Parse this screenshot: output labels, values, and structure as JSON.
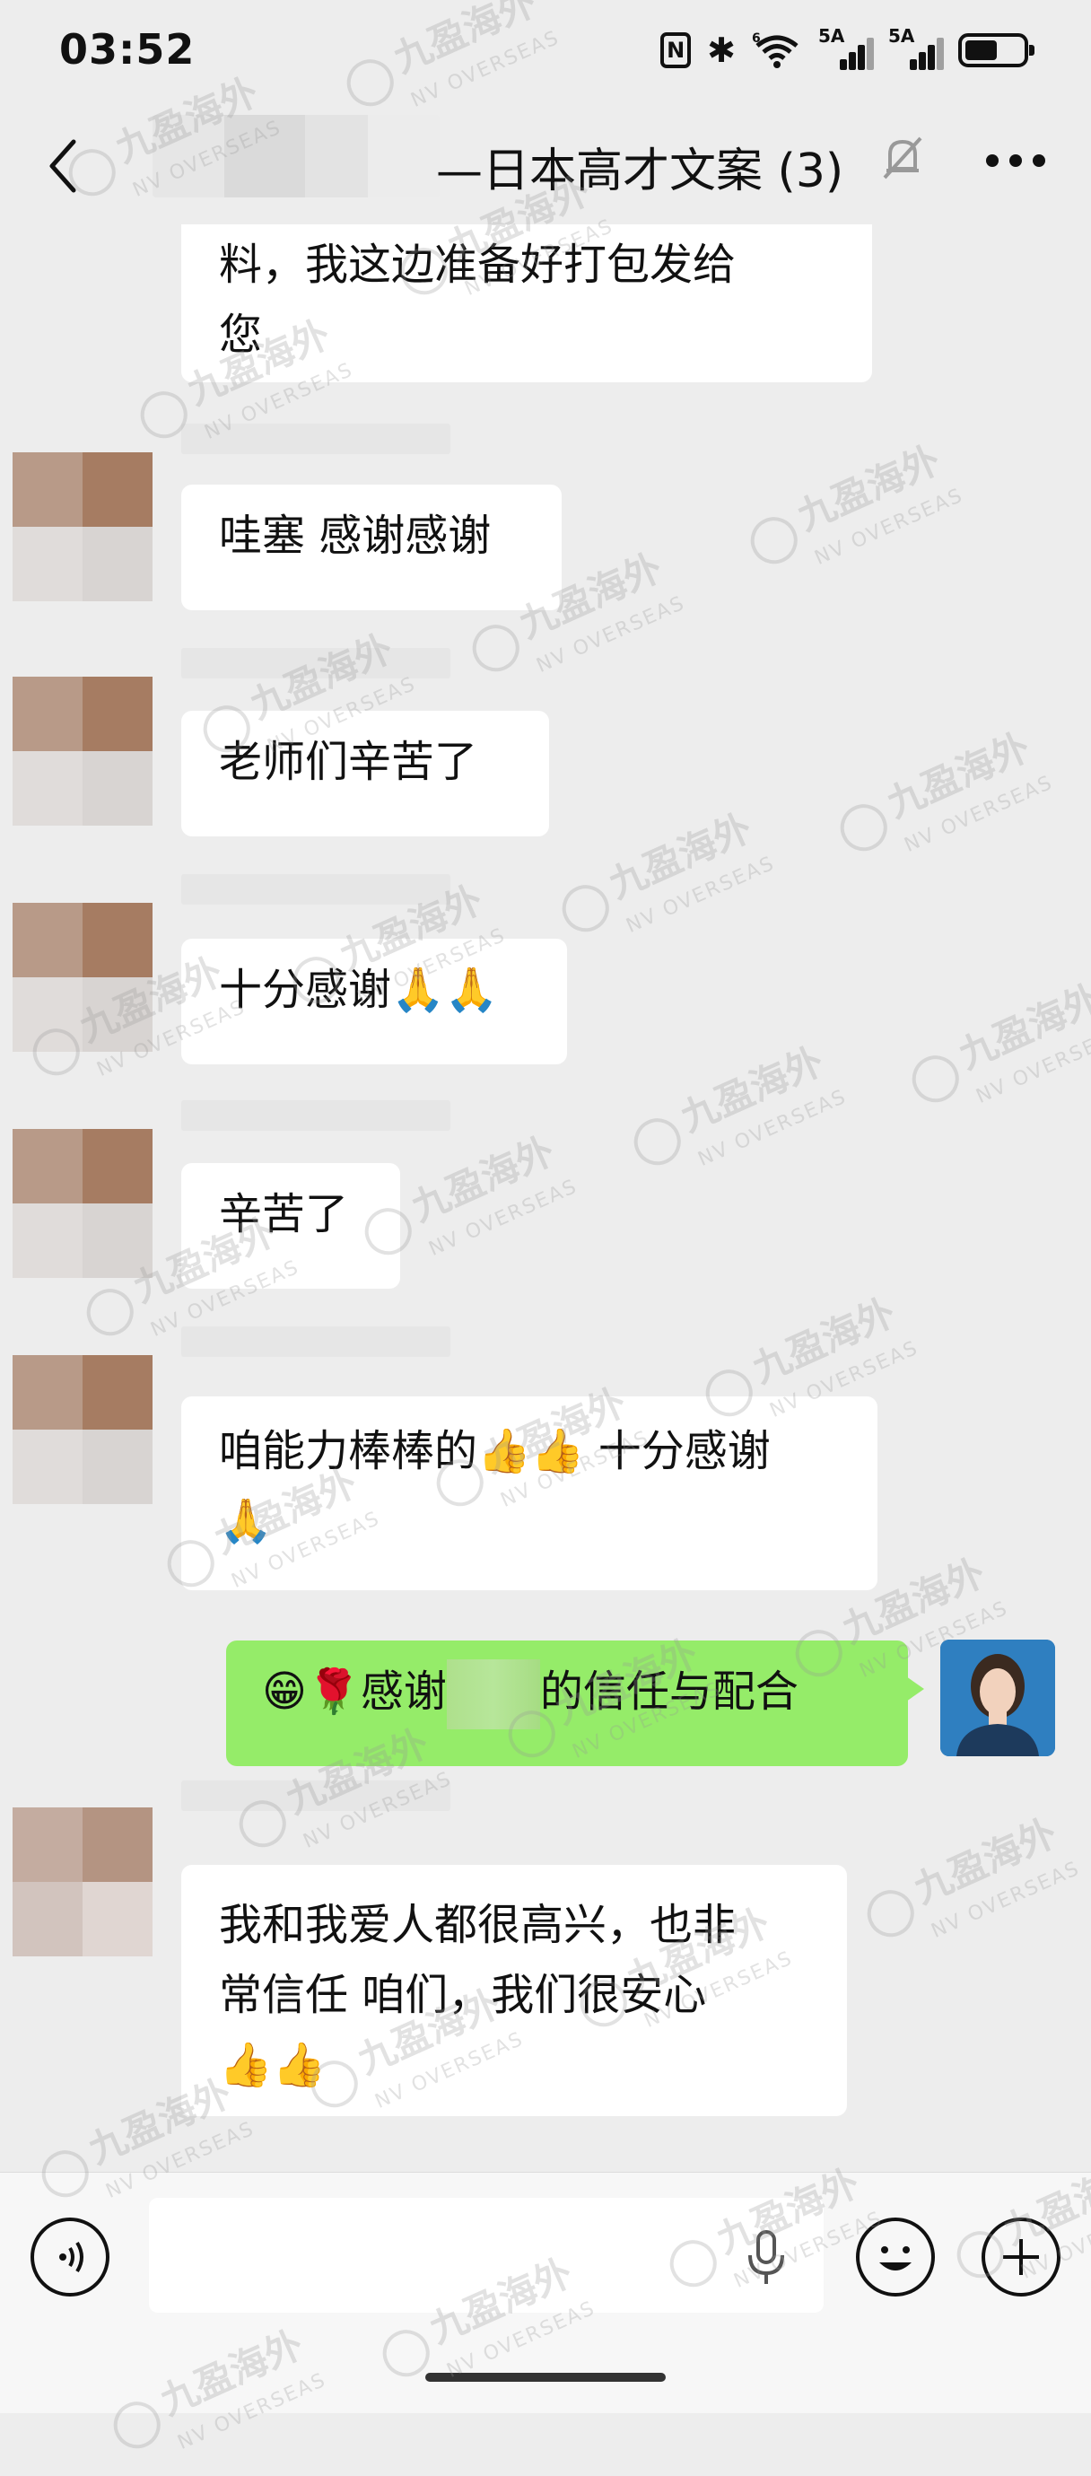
{
  "status_bar": {
    "time": "03:52",
    "nfc_label": "N",
    "bluetooth_glyph": "✱",
    "wifi_label": "6",
    "signal1_label": "5A",
    "signal2_label": "5A",
    "battery_level": 0.56
  },
  "header": {
    "title": "—日本高才文案 (3)"
  },
  "messages": [
    {
      "from": "other",
      "text_line1": "料，我这边准备好打包发给",
      "text_line2": "您"
    },
    {
      "from": "other",
      "text": "哇塞 感谢感谢"
    },
    {
      "from": "other",
      "text": "老师们辛苦了"
    },
    {
      "from": "other",
      "text": "十分感谢",
      "emoji": "🙏🙏"
    },
    {
      "from": "other",
      "text": "辛苦了"
    },
    {
      "from": "other",
      "text_a": "咱能力棒棒的",
      "emoji_a": "👍👍",
      "text_b": " 十分感谢",
      "emoji_b": "🙏"
    },
    {
      "from": "me",
      "emoji": "😁🌹",
      "text_a": "感谢",
      "text_b": "的信任与配合"
    },
    {
      "from": "other",
      "text_line1": "我和我爱人都很高兴，也非",
      "text_line2": "常信任 咱们，我们很安心",
      "emoji": "👍👍"
    }
  ],
  "watermark": {
    "cn": "九盈海外",
    "en": "NV OVERSEAS"
  },
  "colors": {
    "background": "#ededed",
    "my_bubble": "#95ec69",
    "other_bubble": "#ffffff"
  },
  "icons": [
    "back-icon",
    "mute-bell-icon",
    "more-icon",
    "voice-icon",
    "mic-icon",
    "emoji-icon",
    "plus-icon"
  ]
}
